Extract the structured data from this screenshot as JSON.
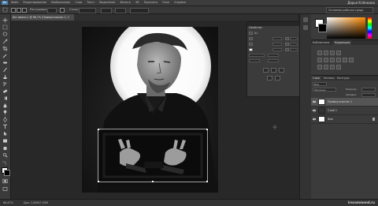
{
  "menubar": {
    "logo_text": "Ps",
    "items": [
      "Файл",
      "Редактирование",
      "Изображение",
      "Слои",
      "Текст",
      "Выделение",
      "Фильтр",
      "3D",
      "Просмотр",
      "Окно",
      "Справка"
    ],
    "user_name": "Дарья Клёнкина"
  },
  "optionsbar": {
    "field1_label": "Растушевка",
    "style_label": "Стиль:",
    "right_field_value": "Основная рабочая среда"
  },
  "document_tab": {
    "label": "Без имени-1 @ 66,7% (Прямоугольник 1, RGB/8) *",
    "close_glyph": "×"
  },
  "floating_panel": {
    "title": "Свойства",
    "rows": [
      {
        "label": "Ш:",
        "value": "",
        "value2": ""
      },
      {
        "label": "X:",
        "value": "",
        "value2": ""
      },
      {
        "label": "",
        "value": "",
        "value2": ""
      },
      {
        "label": "",
        "value": "",
        "value2": ""
      },
      {
        "label": "",
        "value": "",
        "value2": ""
      }
    ]
  },
  "color_panel": {
    "foreground_color": "#ffffff",
    "background_color": "#000000"
  },
  "adjustments_panel": {
    "tabs": [
      "Библиотеки",
      "Коррекция"
    ],
    "active_tab_index": 1
  },
  "layers_panel": {
    "tabs": [
      "Слои",
      "Каналы",
      "Контуры"
    ],
    "active_tab_index": 0,
    "filter_label": "Вид",
    "blend_mode": "Обычные",
    "opacity_label": "Непрозр.:",
    "fill_label": "Заливка:",
    "layers": [
      {
        "name": "Прямоугольник 1",
        "selected": true
      },
      {
        "name": "Слой 1",
        "selected": false
      },
      {
        "name": "Фон",
        "selected": false
      }
    ]
  },
  "statusbar": {
    "zoom": "66,67%",
    "doc_info": "Док: 2,64М/7,03М"
  },
  "watermark": {
    "text": "irecommend.ru"
  },
  "colors": {
    "ui_dark": "#282828",
    "panel": "#3b3b3b",
    "accent_blue": "#4a7fb0",
    "selection_rect": "#ffffff"
  }
}
